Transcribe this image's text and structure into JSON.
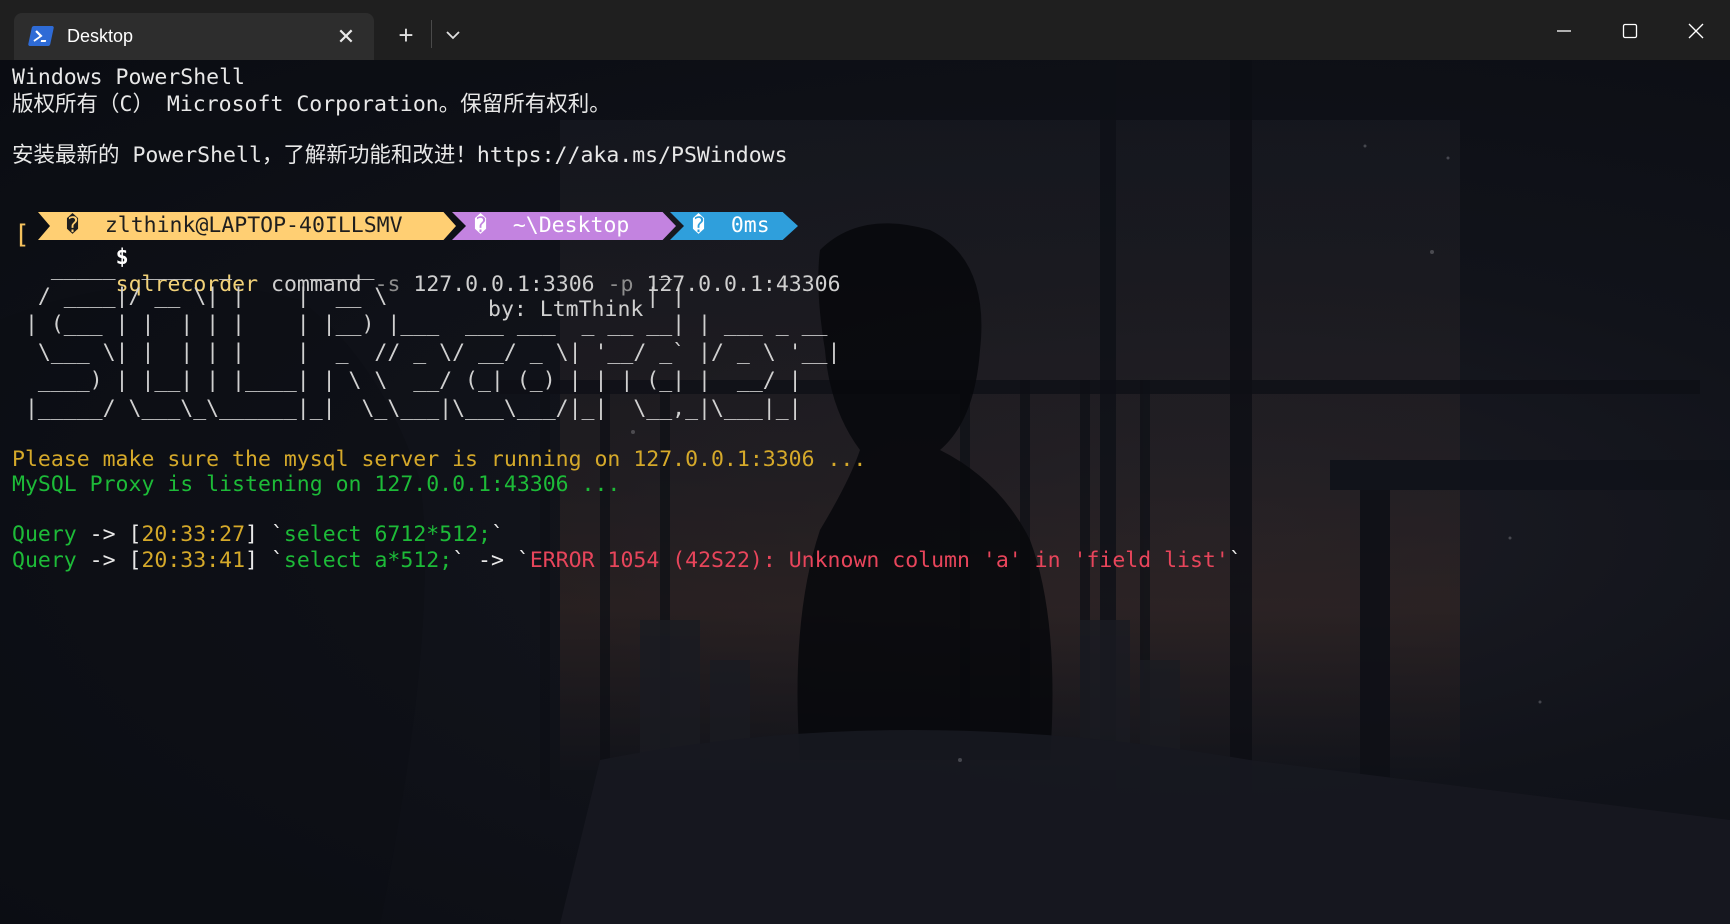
{
  "tab": {
    "title": "Desktop",
    "icon": "powershell-icon"
  },
  "titlebar": {
    "new_tab": "+",
    "close_tab": "✕"
  },
  "terminal": {
    "header_line1": "Windows PowerShell",
    "header_line2": "版权所有（C） Microsoft Corporation。保留所有权利。",
    "header_line3": "安装最新的 PowerShell，了解新功能和改进！https://aka.ms/PSWindows",
    "prompt": {
      "bracket": "[",
      "user_segment": "�  zlthink@LAPTOP-40ILLSMV",
      "path_segment": "�  ~\\Desktop",
      "time_segment": "�  0ms",
      "symbol": "$",
      "command": "sqlrecorder",
      "args": [
        {
          "text": " command ",
          "kind": "plain"
        },
        {
          "text": "-s",
          "kind": "flag"
        },
        {
          "text": " 127.0.0.1:3306 ",
          "kind": "plain"
        },
        {
          "text": "-p",
          "kind": "flag"
        },
        {
          "text": " 127.0.0.1:43306",
          "kind": "plain"
        }
      ]
    },
    "banner": {
      "art": "   _____  ____  _      _____                      _\n  / ____|/ __ \\| |    |  __ \\                    | |\n | (___ | |  | | |    | |__) |___  ___ ___  _ __ __| | ___ _ __\n  \\___ \\| |  | | |    |  _  // _ \\/ __/ _ \\| '__/ _` |/ _ \\ '__|\n  ____) | |__| | |____| | \\ \\  __/ (_| (_) | | | (_| |  __/ |\n |_____/ \\___\\_\\______|_|  \\_\\___|\\___\\___/|_|  \\__,_|\\___|_|",
      "byline": "by: LtmThink"
    },
    "notice": "Please make sure the mysql server is running on 127.0.0.1:3306 ...",
    "listening": "MySQL Proxy is listening on 127.0.0.1:43306 ...",
    "queries": [
      {
        "label": "Query",
        "arrow": " -> [",
        "time": "20:33:27",
        "close": "] `",
        "sql": "select 6712*512;",
        "end": "`",
        "result_arrow": "",
        "result_open": "",
        "error": "",
        "result_close": ""
      },
      {
        "label": "Query",
        "arrow": " -> [",
        "time": "20:33:41",
        "close": "] `",
        "sql": "select a*512;",
        "end": "`",
        "result_arrow": " -> `",
        "result_open": "",
        "error": "ERROR 1054 (42S22): Unknown column 'a' in 'field list'",
        "result_close": "`"
      }
    ]
  },
  "colors": {
    "user_segment": "#ffcf73",
    "path_segment": "#c383e0",
    "time_segment": "#2f9fdc",
    "notice": "#d5a92a",
    "listening": "#1dbb38",
    "error": "#e8455b"
  }
}
